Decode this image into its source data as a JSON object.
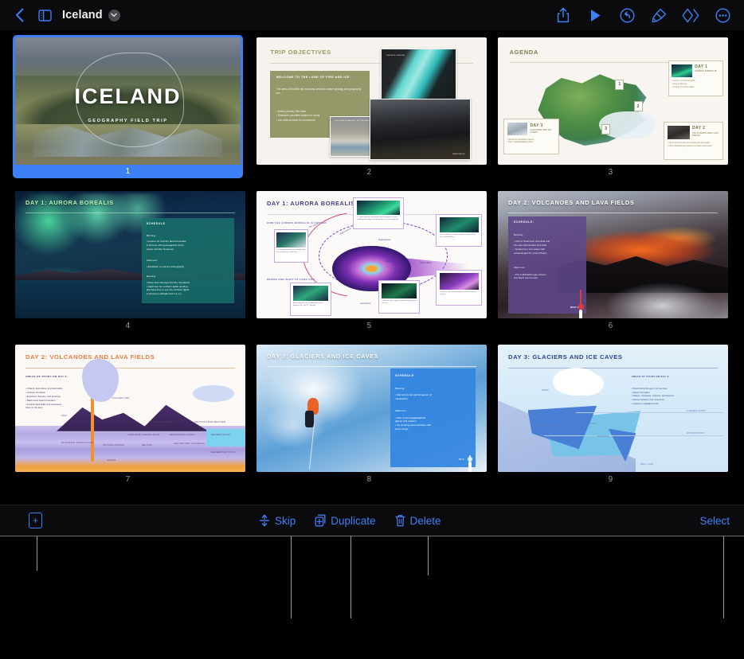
{
  "app": {
    "name": "Keynote",
    "accent_color": "#3d80f5",
    "background_color": "#000000",
    "toolbar_background": "#0b0b0d"
  },
  "topbar": {
    "back_label": "Back",
    "back_icon": "chevron-left-icon",
    "sidebar_icon": "sidebar-toggle-icon",
    "document_title": "Iceland",
    "title_chevron_icon": "chevron-down-icon",
    "actions": [
      {
        "name": "share",
        "label": "Share",
        "icon": "share-icon"
      },
      {
        "name": "play",
        "label": "Play",
        "icon": "play-icon"
      },
      {
        "name": "undo",
        "label": "Undo",
        "icon": "undo-icon"
      },
      {
        "name": "format",
        "label": "Format",
        "icon": "paintbrush-icon"
      },
      {
        "name": "animate",
        "label": "Animate",
        "icon": "animate-diamonds-icon"
      },
      {
        "name": "more",
        "label": "More",
        "icon": "ellipsis-circle-icon"
      }
    ]
  },
  "bottombar": {
    "add_label": "+",
    "add_name": "add-slide-button",
    "items": [
      {
        "label": "Skip",
        "icon": "skip-slide-icon",
        "name": "skip-button"
      },
      {
        "label": "Duplicate",
        "icon": "duplicate-icon",
        "name": "duplicate-button"
      },
      {
        "label": "Delete",
        "icon": "trash-icon",
        "name": "delete-button"
      }
    ],
    "select_label": "Select"
  },
  "navigator": {
    "selected_slide": 1,
    "slide_count": 9,
    "slides": [
      {
        "number": "1",
        "selected": true,
        "title": "ICELAND",
        "subtitle": "GEOGRAPHY FIELD TRIP",
        "kind": "title-photo"
      },
      {
        "number": "2",
        "selected": false,
        "title": "TRIP OBJECTIVES",
        "kind": "text-and-photos",
        "box_heading": "WELCOME TO THE LAND OF FIRE AND ICE",
        "box_body": "The aims of this field trip exploring Iceland's unique geology and geography are:",
        "box_list": "• Gather primary field data\n• Research specialist subject for essay\n• Use data as basis for coursework",
        "photo_captions": [
          "THE BLUE LAGOON",
          "THE LAND'S LARGEST HOT SPRING BOILING POOL",
          "LAVA FIELDS"
        ]
      },
      {
        "number": "3",
        "selected": false,
        "title": "AGENDA",
        "kind": "map",
        "pins": [
          "1",
          "2",
          "3"
        ],
        "cards": [
          {
            "day": "DAY 1",
            "subject": "AURORA BOREALIS",
            "bullets": "• Lecture on aurora borealis\n• Drive to Akureyri\n• Viewing of northern lights"
          },
          {
            "day": "DAY 2",
            "subject": "VOLCANOES AND LAVA FIELDS",
            "bullets": "• Trip to the Holuhraun and Nornahraun lava fields\n• Visit to Bárðarbunga volcano and black sand beach"
          },
          {
            "day": "DAY 3",
            "subject": "GLACIERS AND ICE CAVES",
            "bullets": "• Sail across Jökulsárlón lagoon\n• Hike on Eyjafjallajökull glacier"
          }
        ]
      },
      {
        "number": "4",
        "selected": false,
        "title": "DAY 1: AURORA BOREALIS",
        "kind": "schedule-photo",
        "panel_heading": "SCHEDULE",
        "panel_morning_label": "Morning:",
        "panel_morning": "• Lecture on how the aurora borealis\n   is formed, with geomagnetic storm\n   expert Jennifer Sorensen",
        "panel_afternoon_label": "Afternoon:",
        "panel_afternoon": "• Exhibition on aurora photography",
        "panel_evening_label": "Evening:",
        "panel_evening": "• Drive from Akureyri into the mountains\n• Night tour for northern lights spotting\n   (the best time to see the northern lights\n   is between midnight and 2 a.m.)"
      },
      {
        "number": "5",
        "selected": false,
        "title": "DAY 1: AURORA BOREALIS",
        "kind": "diagram",
        "section_1": "HOW THE AURORA BOREALIS IS FORMED",
        "section_2": "WHERE AND WHAT TO LOOK FOR",
        "callouts": [
          "1. Charged particles are emitted from the sun during a solar flare",
          "2. These particles penetrate Earth's magnetic shield, colliding with atoms and molecules in our atmosphere",
          "3. The collisions create countless tiny bursts of light called photons",
          "Aurora borealis most commonly occurs between 65° and 72° latitude",
          "Collisions with oxygen produce red and green auroras",
          "Collisions with nitrogen produce pink and purple auroras"
        ],
        "annotations": [
          "Bow Shock",
          "Magnetosphere",
          "Magnetopause",
          "Plasma Sheet",
          "Radiation Belts",
          "Auroral Zone",
          "Tail"
        ]
      },
      {
        "number": "6",
        "selected": false,
        "title": "DAY 2: VOLCANOES AND LAVA FIELDS",
        "kind": "schedule-photo",
        "panel_heading": "SCHEDULE:",
        "panel_morning_label": "Morning:",
        "panel_morning": "• Visit to Holuhraun lava field and\n   the new Nornahraun lava field\n• Guided tour of a crater with\n   volcanologist Dr. Grant Phelps",
        "panel_afternoon_label": "Afternoon:",
        "panel_afternoon": "• Trip to Bárðarbunga volcano\n   and black sand beach",
        "temperature": "2010° F"
      },
      {
        "number": "7",
        "selected": false,
        "title": "DAY 2: VOLCANOES AND LAVA FIELDS",
        "kind": "diagram",
        "heading": "AREAS OF STUDY ON DAY 2:",
        "bullets": "• Craters, lava tubes, and lava fields\n• Volcano formation\n• Eruptions, fissures, and structure\n• Black sand beach formation\n• Impacts lava fields and volcanoes\n   have on the land",
        "labels": [
          "VOLCANIC ASH",
          "LAVA",
          "SPLATTER CONTENT",
          "EROSION FROM WEATHER",
          "SEDIMENTATION",
          "INTRUSIVE IGNEOUS ROCK",
          "METAMORPHIC ROCK",
          "EXTRUSIVE IGNEOUS ROCK",
          "CRYSTALLIZATION",
          "MELTING",
          "HEATING AND SQUEEZING",
          "SEDIMENTARY ROCK",
          "MAGMA"
        ]
      },
      {
        "number": "8",
        "selected": false,
        "title": "DAY 3: GLACIERS AND ICE CAVES",
        "kind": "schedule-photo",
        "panel_heading": "SCHEDULE",
        "panel_morning_label": "Morning:",
        "panel_morning": "• Sail across the glacial lagoon of\n   Jökulsárlón",
        "panel_afternoon_label": "Afternoon:",
        "panel_afternoon": "• Hike on the Eyjafjallajökull\n   glacier and volcano\n• Ice climbing demonstration with\n   Kevin Angel",
        "temperature": "14° F"
      },
      {
        "number": "9",
        "selected": false,
        "title": "DAY 3: GLACIERS AND ICE CAVES",
        "kind": "diagram",
        "heading": "AREAS OF STUDY ON DAY 3:",
        "bullets": "• Determining the age of an ice cave\n• Glacier formation\n• Valleys, crevasses, canyons, and fissures\n• Glacier behavior and movement\n• Impact on seawater levels",
        "labels": [
          "SNOW",
          "METAMORPHIC ICE",
          "GLACIER ICE",
          "CREVASSE",
          "SUMMER FROST",
          "WINTER FROST",
          "MELT LAKE"
        ]
      }
    ]
  }
}
